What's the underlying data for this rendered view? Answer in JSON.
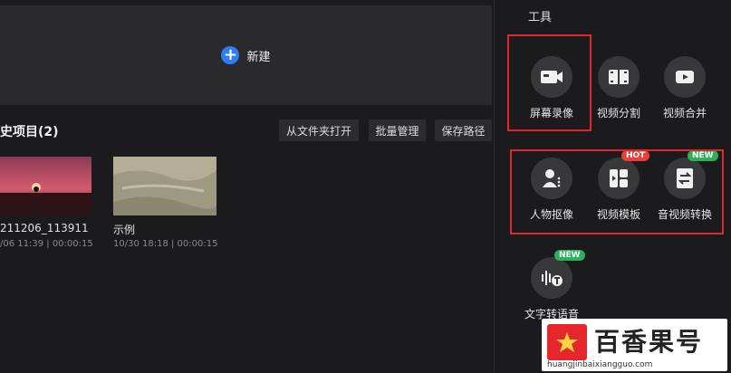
{
  "main": {
    "new_label": "新建",
    "history_title": "史项目(2)",
    "buttons": {
      "open_folder": "从文件夹打开",
      "batch_manage": "批量管理",
      "save_path": "保存路径"
    },
    "projects": [
      {
        "name": "211206_113911",
        "meta": "/06 11:39 | 00:00:15"
      },
      {
        "name": "示例",
        "meta": "10/30 18:18 | 00:00:15"
      }
    ]
  },
  "tools": {
    "title": "工具",
    "items": [
      {
        "label": "屏幕录像",
        "icon": "camera-icon"
      },
      {
        "label": "视频分割",
        "icon": "film-split-icon"
      },
      {
        "label": "视频合并",
        "icon": "video-merge-icon"
      },
      {
        "label": "人物抠像",
        "icon": "person-cutout-icon"
      },
      {
        "label": "视频模板",
        "icon": "template-icon",
        "badge": "HOT"
      },
      {
        "label": "音视频转换",
        "icon": "convert-icon",
        "badge": "NEW"
      },
      {
        "label": "文字转语音",
        "icon": "text-to-speech-icon",
        "badge": "NEW"
      }
    ]
  },
  "watermark": {
    "text": "百香果号",
    "url": "huangjinbaixiangguo.com"
  },
  "colors": {
    "accent": "#2f7cf6",
    "highlight": "#e3262a",
    "hot": "#e9403b",
    "new": "#2bb05c"
  }
}
